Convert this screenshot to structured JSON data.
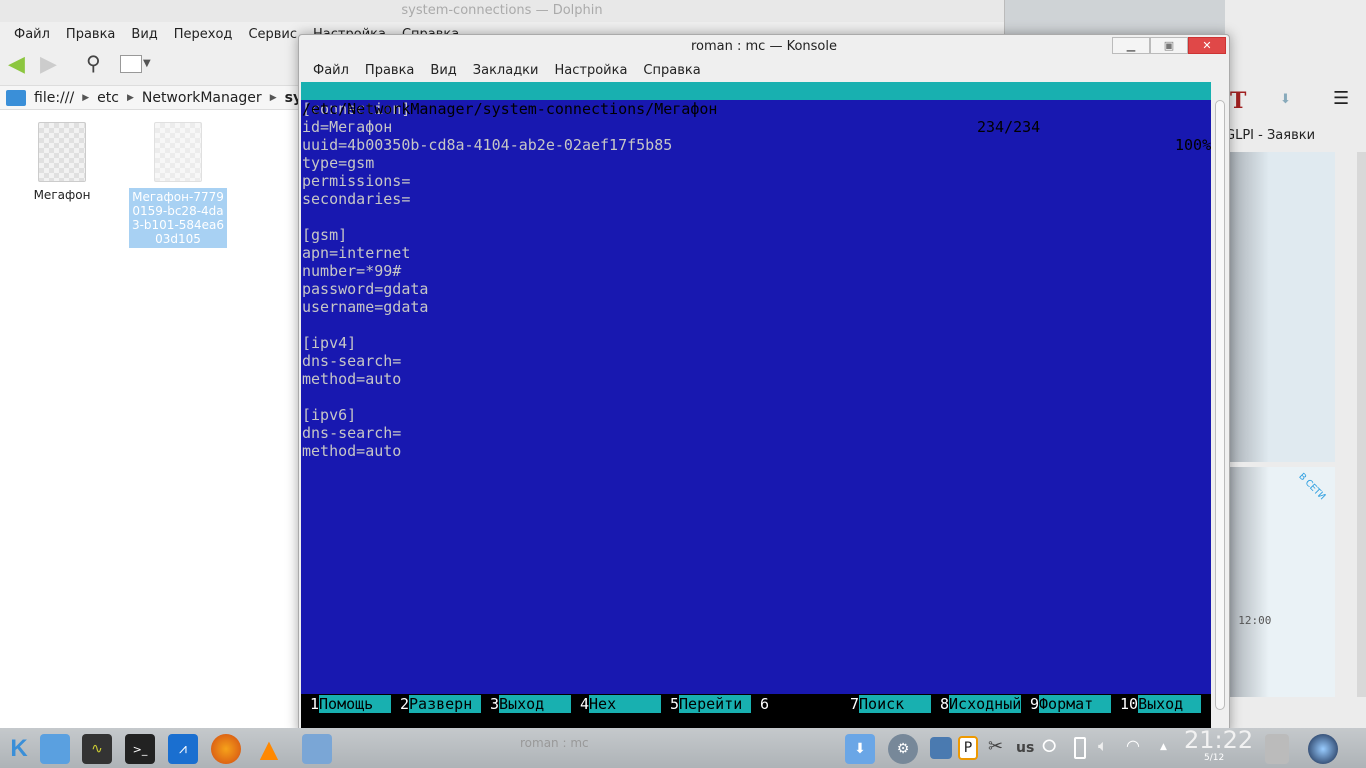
{
  "dolphin": {
    "title": "system-connections — Dolphin",
    "menu": [
      "Файл",
      "Правка",
      "Вид",
      "Переход",
      "Сервис",
      "Настройка",
      "Справка"
    ],
    "breadcrumb": [
      "file:///",
      "etc",
      "NetworkManager",
      "system-"
    ],
    "files": [
      {
        "name": "Мегафон",
        "selected": false
      },
      {
        "name": "Мегафон-77790159-bc28-4da3-b101-584ea603d105",
        "selected": true
      }
    ]
  },
  "browser": {
    "bookmark": "GLPI - Заявки",
    "badge": "В СЕТИ",
    "time": ", 12:00"
  },
  "konsole": {
    "title": "roman : mc — Konsole",
    "menu": [
      "Файл",
      "Правка",
      "Вид",
      "Закладки",
      "Настройка",
      "Справка"
    ],
    "status": {
      "path": "/etc/NetworkManager/system-connections/Мегафон",
      "position": "234/234",
      "percent": "100%"
    },
    "lines": [
      "[connection]",
      "id=Мегафон",
      "uuid=4b00350b-cd8a-4104-ab2e-02aef17f5b85",
      "type=gsm",
      "permissions=",
      "secondaries=",
      "",
      "[gsm]",
      "apn=internet",
      "number=*99#",
      "password=gdata",
      "username=gdata",
      "",
      "[ipv4]",
      "dns-search=",
      "method=auto",
      "",
      "[ipv6]",
      "dns-search=",
      "method=auto"
    ],
    "fkeys": [
      {
        "n": "1",
        "label": "Помощь"
      },
      {
        "n": "2",
        "label": "Разверн"
      },
      {
        "n": "3",
        "label": "Выход"
      },
      {
        "n": "4",
        "label": "Hex"
      },
      {
        "n": "5",
        "label": "Перейти"
      },
      {
        "n": "6",
        "label": ""
      },
      {
        "n": "7",
        "label": "Поиск"
      },
      {
        "n": "8",
        "label": "Исходный"
      },
      {
        "n": "9",
        "label": "Формат"
      },
      {
        "n": "10",
        "label": "Выход"
      }
    ]
  },
  "taskbar": {
    "task_label": "roman : mc",
    "keyboard_layout": "us",
    "clock": "21:22",
    "date": "5/12"
  }
}
